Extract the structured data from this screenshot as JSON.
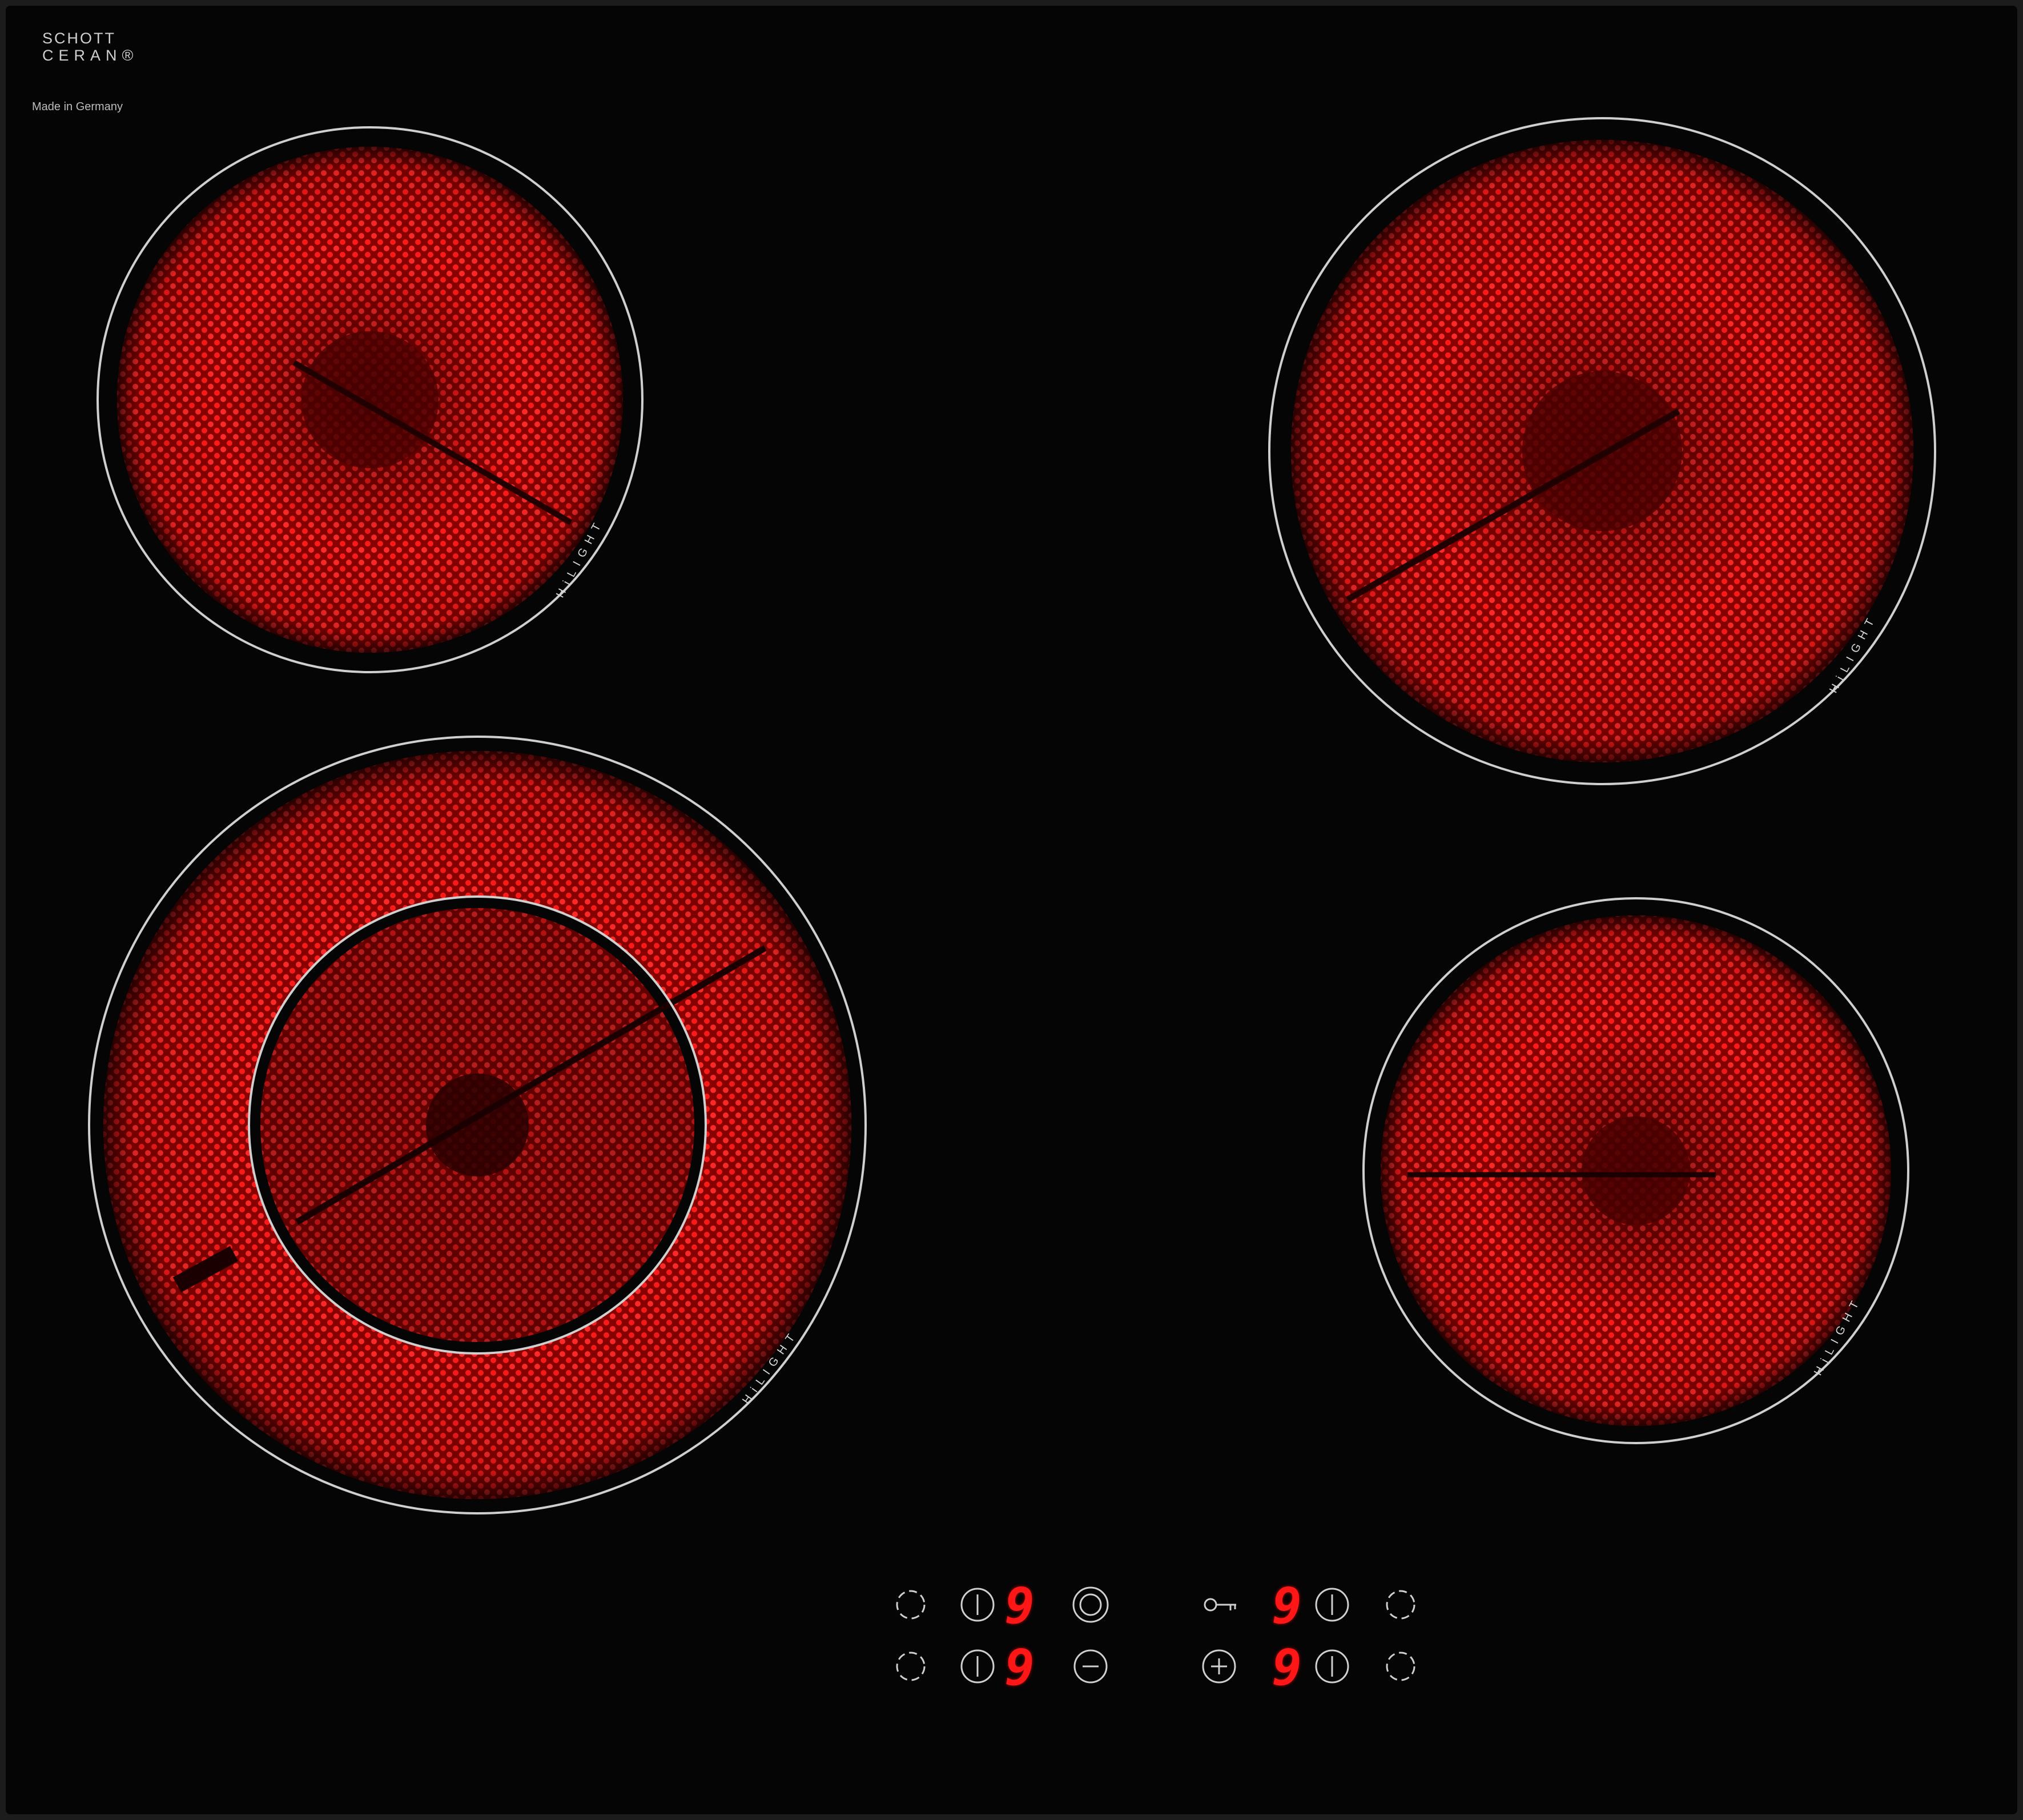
{
  "brand": {
    "line1": "SCHOTT",
    "line2": "CERAN®"
  },
  "made_in": "Made in Germany",
  "zone_label": "HiLIGHT",
  "displays": {
    "front_left": "9",
    "rear_left": "9",
    "rear_right": "9",
    "front_right": "9"
  },
  "colors": {
    "glass": "#050505",
    "frame": "#1c1c1c",
    "glow": "#ff1010",
    "ring": "#cfcfcf",
    "display": "#ff1616"
  },
  "controls": {
    "icons": [
      "timer-icon",
      "power-icon",
      "dual-zone-icon",
      "key-lock-icon",
      "minus-icon",
      "plus-icon"
    ]
  }
}
